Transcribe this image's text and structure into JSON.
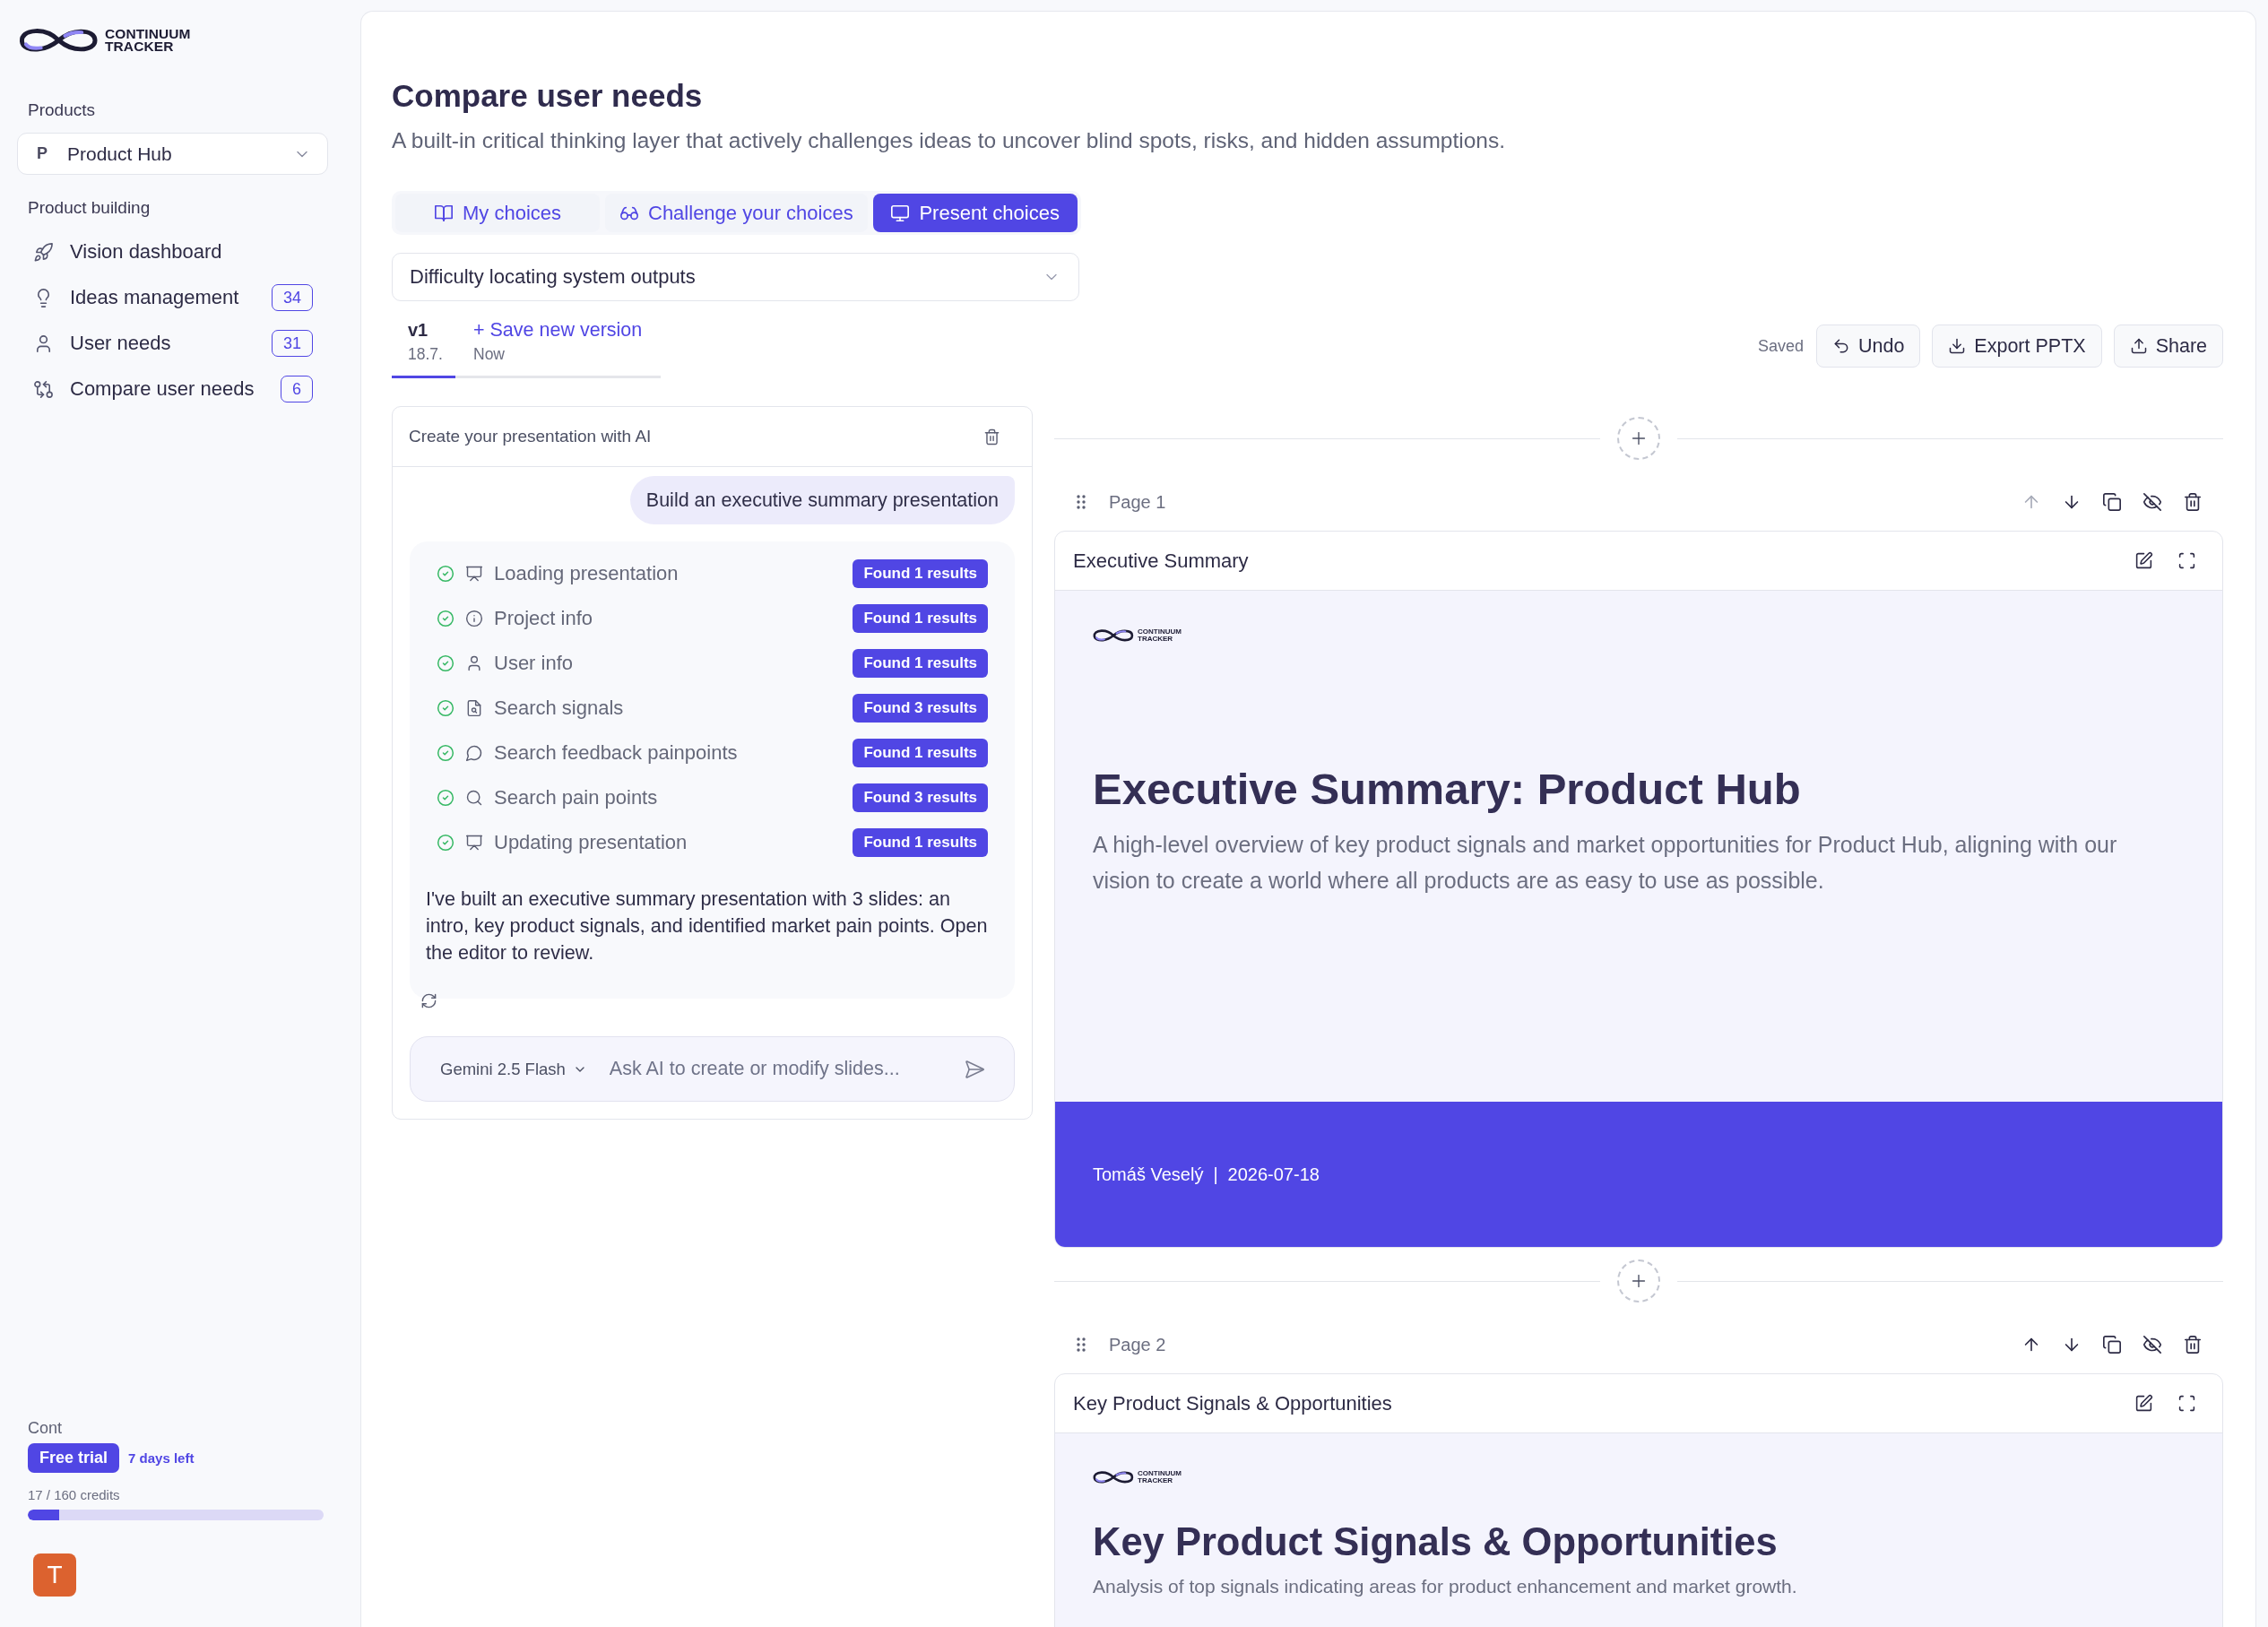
{
  "sidebar": {
    "logo": {
      "lines": [
        "CONTINUUM",
        "TRACKER"
      ]
    },
    "products_label": "Products",
    "product_select": {
      "initial": "P",
      "value": "Product Hub"
    },
    "section_label": "Product building",
    "nav_items": [
      {
        "label": "Vision dashboard"
      },
      {
        "label": "Ideas management",
        "badge": "34"
      },
      {
        "label": "User needs",
        "badge": "31"
      },
      {
        "label": "Compare user needs",
        "badge": "6"
      }
    ],
    "plan": {
      "label": "Cont",
      "badge": "Free trial",
      "days_left": "7 days left",
      "credits": "17 / 160 credits",
      "level": 0.106
    },
    "avatar": {
      "initial": "T"
    }
  },
  "main": {
    "title": "Compare user needs",
    "subtitle": "A built-in critical thinking layer that actively challenges ideas to uncover blind spots, risks, and hidden assumptions.",
    "tabs": [
      {
        "label": "My choices",
        "selected": false
      },
      {
        "label": "Challenge your choices",
        "selected": false
      },
      {
        "label": "Present choices",
        "selected": true
      }
    ],
    "need_select": {
      "value": "Difficulty locating system outputs"
    },
    "versions": [
      {
        "kind": "version",
        "label": "v1",
        "date": "18.7.",
        "selected": true
      },
      {
        "kind": "action",
        "label": "+ Save new version",
        "date": "Now",
        "selected": false
      }
    ],
    "toolbar": {
      "status": "Saved",
      "buttons": [
        {
          "label": "Undo"
        },
        {
          "label": "Export PPTX"
        },
        {
          "label": "Share"
        }
      ]
    },
    "chat": {
      "title": "Create your presentation with AI",
      "user_message": "Build an executive summary presentation",
      "steps": [
        {
          "label": "Loading presentation",
          "result": "Found 1 results",
          "done": true
        },
        {
          "label": "Project info",
          "result": "Found 1 results",
          "done": true
        },
        {
          "label": "User info",
          "result": "Found 1 results",
          "done": true
        },
        {
          "label": "Search signals",
          "result": "Found 3 results",
          "done": true
        },
        {
          "label": "Search feedback painpoints",
          "result": "Found 1 results",
          "done": true
        },
        {
          "label": "Search pain points",
          "result": "Found 3 results",
          "done": true
        },
        {
          "label": "Updating presentation",
          "result": "Found 1 results",
          "done": true
        }
      ],
      "reply": "I've built an executive summary presentation with 3 slides: an intro, key product signals, and identified market pain points. Open the editor to review.",
      "model": "Gemini 2.5 Flash",
      "input": {
        "placeholder": "Ask AI to create or modify slides..."
      }
    },
    "slides": [
      {
        "page": "Page 1",
        "move_up_disabled": true,
        "title": "Executive Summary",
        "kind": "cover",
        "logo_lines": [
          "CONTINUUM",
          "TRACKER"
        ],
        "heading": "Executive Summary: Product Hub",
        "description": "A high-level overview of key product signals and market opportunities for Product Hub, aligning with our vision to create a world where all products are as easy to use as possible.",
        "footer": {
          "author": "Tomáš Veselý",
          "separator": "|",
          "date": "2026-07-18"
        }
      },
      {
        "page": "Page 2",
        "move_up_disabled": false,
        "title": "Key Product Signals & Opportunities",
        "kind": "content",
        "logo_lines": [
          "CONTINUUM",
          "TRACKER"
        ],
        "heading": "Key Product Signals & Opportunities",
        "description": "Analysis of top signals indicating areas for product enhancement and market growth."
      }
    ]
  }
}
